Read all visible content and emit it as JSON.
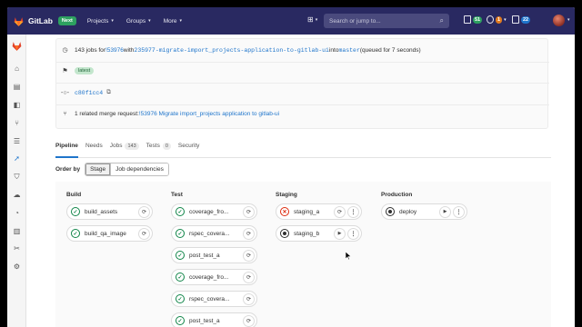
{
  "topbar": {
    "brand": "GitLab",
    "next_badge": "Next",
    "nav": [
      "Projects",
      "Groups",
      "More"
    ],
    "search_placeholder": "Search or jump to...",
    "counters": [
      {
        "name": "issues",
        "value": "51",
        "color": "#2da160"
      },
      {
        "name": "merge-requests",
        "value": "1",
        "color": "#e07a1f"
      },
      {
        "name": "todos",
        "value": "22",
        "color": "#1f75cb"
      }
    ]
  },
  "summary": {
    "jobs_prefix": "143 jobs for ",
    "pipeline_id": "!53976",
    "with_text": " with ",
    "branch": "235977-migrate-import_projects-application-to-gitlab-ui",
    "into_text": " into ",
    "target_branch": "master",
    "queued_text": " (queued for 7 seconds)",
    "tag": "latest",
    "commit_sha": "c80f1cc4",
    "mr_prefix": "1 related merge request: ",
    "mr_link": "!53976 Migrate import_projects application to gitlab-ui"
  },
  "tabs": [
    {
      "label": "Pipeline",
      "count": "",
      "active": true
    },
    {
      "label": "Needs",
      "count": "",
      "active": false
    },
    {
      "label": "Jobs",
      "count": "143",
      "active": false
    },
    {
      "label": "Tests",
      "count": "0",
      "active": false
    },
    {
      "label": "Security",
      "count": "",
      "active": false
    }
  ],
  "order_by": {
    "label": "Order by",
    "options": [
      "Stage",
      "Job dependencies"
    ],
    "selected": "Stage"
  },
  "stages": [
    {
      "name": "Build",
      "jobs": [
        {
          "name": "build_assets",
          "status": "success",
          "action": "retry"
        },
        {
          "name": "build_qa_image",
          "status": "success",
          "action": "retry"
        }
      ]
    },
    {
      "name": "Test",
      "jobs": [
        {
          "name": "coverage_fro...",
          "status": "success",
          "action": "retry"
        },
        {
          "name": "rspec_covera...",
          "status": "success",
          "action": "retry"
        },
        {
          "name": "post_test_a",
          "status": "success",
          "action": "retry"
        },
        {
          "name": "coverage_fro...",
          "status": "success",
          "action": "retry"
        },
        {
          "name": "rspec_covera...",
          "status": "success",
          "action": "retry"
        },
        {
          "name": "post_test_a",
          "status": "success",
          "action": "retry"
        }
      ]
    },
    {
      "name": "Staging",
      "jobs": [
        {
          "name": "staging_a",
          "status": "failed",
          "action": "retry",
          "menu": true
        },
        {
          "name": "staging_b",
          "status": "manual",
          "action": "play",
          "menu": true
        }
      ]
    },
    {
      "name": "Production",
      "jobs": [
        {
          "name": "deploy",
          "status": "manual",
          "action": "play",
          "menu": true
        }
      ]
    }
  ]
}
